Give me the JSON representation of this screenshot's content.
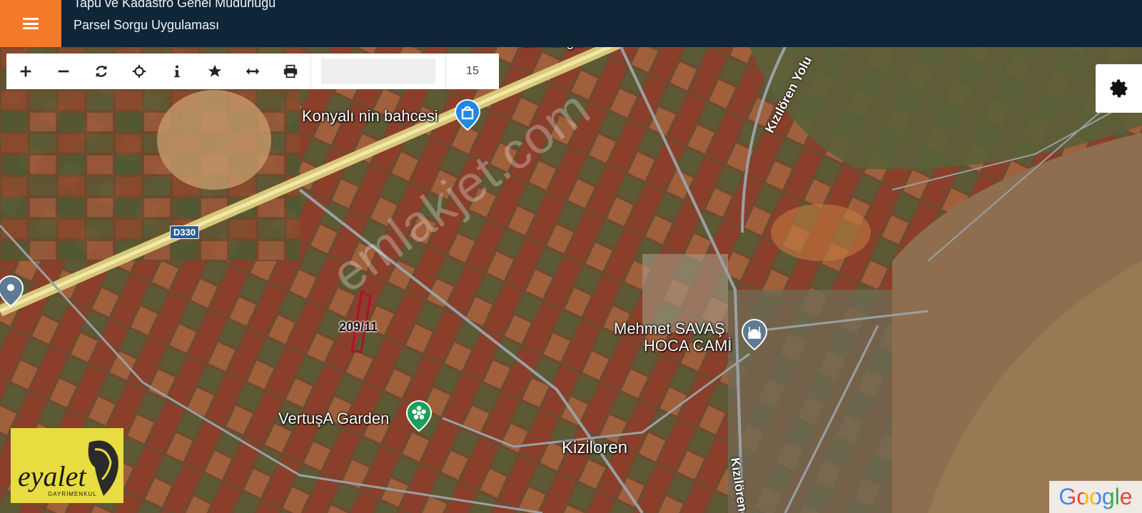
{
  "header": {
    "title": "Tapu ve Kadastro Genel Müdürlüğü",
    "subtitle": "Parsel Sorgu Uygulaması",
    "menu_icon": "hamburger-icon"
  },
  "toolbar": {
    "tools": [
      {
        "name": "zoom-in-button",
        "icon": "plus-icon"
      },
      {
        "name": "zoom-out-button",
        "icon": "minus-icon"
      },
      {
        "name": "refresh-button",
        "icon": "refresh-icon"
      },
      {
        "name": "locate-button",
        "icon": "crosshair-icon"
      },
      {
        "name": "info-button",
        "icon": "info-icon"
      },
      {
        "name": "favorite-button",
        "icon": "star-icon"
      },
      {
        "name": "measure-button",
        "icon": "arrows-horizontal-icon"
      },
      {
        "name": "print-button",
        "icon": "printer-icon"
      }
    ],
    "search_value": "",
    "zoom_level": "15"
  },
  "settings": {
    "icon": "gear-icon"
  },
  "map": {
    "labels": {
      "poi1": "Konyalı nin bahcesi",
      "poi2_line1": "Mehmet SAVAŞ",
      "poi2_line2": "HOCA CAMİ",
      "poi3": "VertuşA Garden",
      "town": "Kiziloren",
      "partial_top": "Et Mangal",
      "road_badge": "D330",
      "road_name1": "Kızılören Yolu",
      "road_name2": "Kızılören",
      "parcel": "209/11"
    },
    "watermark": "emlakjet.com",
    "parcel_color": "#b0102a"
  },
  "logo": {
    "text": "eyalet",
    "sub": "GAYRİMENKUL"
  },
  "attribution": "Google",
  "colors": {
    "header_bg": "#0f2538",
    "menu_bg": "#f47a2a",
    "pin_blue": "#1e88e5",
    "pin_green": "#1b9e5a",
    "pin_gray": "#5f7a94"
  }
}
